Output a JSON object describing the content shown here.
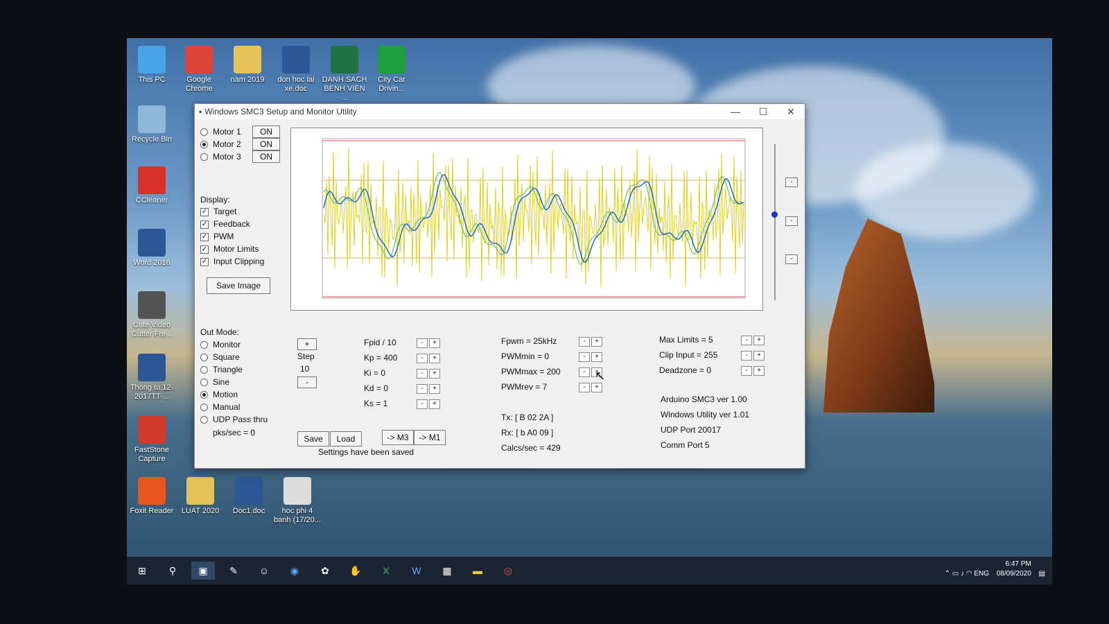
{
  "desktop": {
    "icons": [
      {
        "label": "This PC",
        "icon": "computer-icon",
        "color": "#4aa3e6"
      },
      {
        "label": "Google Chrome",
        "icon": "chrome-icon",
        "color": "#db4437"
      },
      {
        "label": "nam 2019",
        "icon": "folder-icon",
        "color": "#e6c25a"
      },
      {
        "label": "don hoc lai xe.doc",
        "icon": "word-doc-icon",
        "color": "#2b5797"
      },
      {
        "label": "DANH SACH BENH VIEN ...",
        "icon": "excel-doc-icon",
        "color": "#217346"
      },
      {
        "label": "City Car Drivin...",
        "icon": "city-car-icon",
        "color": "#1e9e3c"
      },
      {
        "label": "Recycle Bin",
        "icon": "recycle-bin-icon",
        "color": "#8fb8d8"
      },
      {
        "label": "CCleaner",
        "icon": "ccleaner-icon",
        "color": "#d9322b"
      },
      {
        "label": "Word 2016",
        "icon": "word-icon",
        "color": "#2b5797"
      },
      {
        "label": "Cute Video Cutter Fre...",
        "icon": "film-reel-icon",
        "color": "#555555"
      },
      {
        "label": "Thong tu 12-2017TT-...",
        "icon": "word-doc-icon",
        "color": "#2b5797"
      },
      {
        "label": "FastStone Capture",
        "icon": "faststone-icon",
        "color": "#d23b2b"
      },
      {
        "label": "Foxit Reader",
        "icon": "foxit-icon",
        "color": "#e8551f"
      },
      {
        "label": "LUAT 2020",
        "icon": "folder-icon",
        "color": "#e6c25a"
      },
      {
        "label": "Doc1.doc",
        "icon": "word-doc-icon",
        "color": "#2b5797"
      },
      {
        "label": "hoc phi 4 banh (17/20...",
        "icon": "file-icon",
        "color": "#dddddd"
      }
    ]
  },
  "window": {
    "title": "Windows SMC3 Setup and Monitor Utility",
    "minimize": "—",
    "maximize": "☐",
    "close": "✕"
  },
  "motors": [
    {
      "label": "Motor 1",
      "selected": false,
      "button": "ON"
    },
    {
      "label": "Motor 2",
      "selected": true,
      "button": "ON"
    },
    {
      "label": "Motor 3",
      "selected": false,
      "button": "ON"
    }
  ],
  "display": {
    "heading": "Display:",
    "options": [
      "Target",
      "Feedback",
      "PWM",
      "Motor Limits",
      "Input Clipping"
    ],
    "save_image": "Save Image"
  },
  "outmode": {
    "heading": "Out Mode:",
    "options": [
      "Monitor",
      "Square",
      "Triangle",
      "Sine",
      "Motion",
      "Manual",
      "UDP Pass thru"
    ],
    "selected": "Motion",
    "pks": "pks/sec = 0"
  },
  "step": {
    "plus": "+",
    "label": "Step",
    "value": "10",
    "minus": "-"
  },
  "params_pid": [
    "Fpid / 10",
    "Kp = 400",
    "Ki = 0",
    "Kd = 0",
    "Ks = 1"
  ],
  "params_pwm": [
    "Fpwm = 25kHz",
    "PWMmin = 0",
    "PWMmax = 200",
    "PWMrev = 7"
  ],
  "params_limits": [
    "Max Limits = 5",
    "Clip Input = 255",
    "Deadzone = 0"
  ],
  "comm": {
    "tx": "Tx: [ B 02 2A ]",
    "rx": "Rx: [ b A0 09 ]",
    "calcs": "Calcs/sec = 429"
  },
  "info": [
    "Arduino SMC3 ver 1.00",
    "Windows Utility ver 1.01",
    "UDP Port 20017",
    "Comm Port 5"
  ],
  "buttons": {
    "save": "Save",
    "load": "Load",
    "m3": "-> M3",
    "m1": "-> M1"
  },
  "status": "Settings have been saved",
  "pm_minus": "-",
  "pm_plus": "+",
  "side_buttons": [
    "-",
    "-",
    "-"
  ],
  "tray": {
    "lang": "ENG",
    "time": "6:47 PM",
    "date": "08/09/2020"
  },
  "colors": {
    "target": "#e0d020",
    "feedback": "#7ac36a",
    "pwm": "#1f6fc0",
    "limit": "#e05050"
  }
}
